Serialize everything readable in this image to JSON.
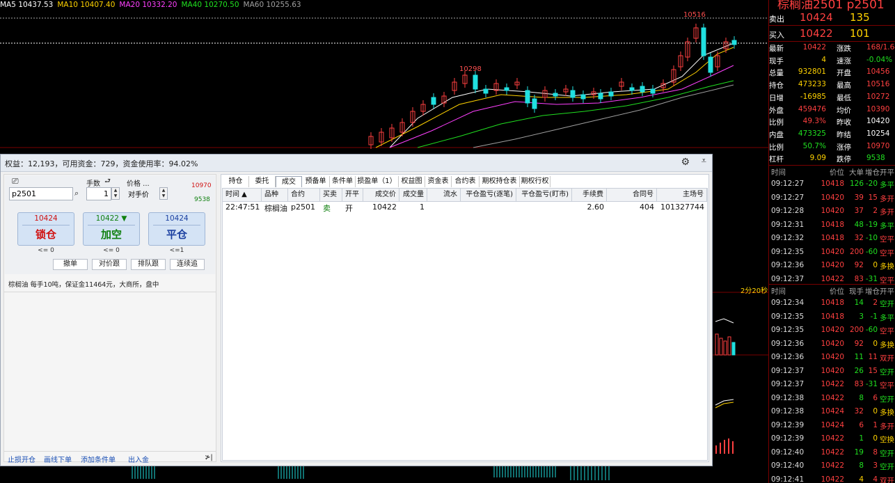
{
  "ma_legend": [
    {
      "label": "MA5 10437.53",
      "color": "#ffffff"
    },
    {
      "label": "MA10 10407.40",
      "color": "#ffd200"
    },
    {
      "label": "MA20 10332.20",
      "color": "#ff40ff"
    },
    {
      "label": "MA40 10270.50",
      "color": "#20e020"
    },
    {
      "label": "MA60 10255.63",
      "color": "#a0a0a0"
    }
  ],
  "chart_annotations": {
    "high_label": "10516",
    "mid_label": "10298",
    "time_label": "2分20秒"
  },
  "quote": {
    "title": "棕榈油2501 p2501",
    "ask": {
      "label": "卖出",
      "price": "10424",
      "volume": "135"
    },
    "bid": {
      "label": "买入",
      "price": "10422",
      "volume": "101"
    },
    "rows": [
      {
        "k1": "最新",
        "v1": "10422",
        "c1": "#ff4040",
        "k2": "涨跌",
        "v2": "168/1.64%",
        "c2": "#ff4040"
      },
      {
        "k1": "现手",
        "v1": "4",
        "c1": "#ffd200",
        "k2": "速涨",
        "v2": "-0.04%",
        "c2": "#20e020"
      },
      {
        "k1": "总量",
        "v1": "932801",
        "c1": "#ffd200",
        "k2": "开盘",
        "v2": "10456",
        "c2": "#ff4040"
      },
      {
        "k1": "持仓",
        "v1": "473233",
        "c1": "#ffd200",
        "k2": "最高",
        "v2": "10516",
        "c2": "#ff4040"
      },
      {
        "k1": "日增",
        "v1": "-16985",
        "c1": "#ffd200",
        "k2": "最低",
        "v2": "10272",
        "c2": "#ff4040"
      },
      {
        "k1": "外盘",
        "v1": "459476",
        "c1": "#ff4040",
        "k2": "均价",
        "v2": "10390",
        "c2": "#ff4040"
      },
      {
        "k1": "比例",
        "v1": "49.3%",
        "c1": "#ff4040",
        "k2": "昨收",
        "v2": "10420",
        "c2": "#ffffff"
      },
      {
        "k1": "内盘",
        "v1": "473325",
        "c1": "#20e020",
        "k2": "昨结",
        "v2": "10254",
        "c2": "#ffffff"
      },
      {
        "k1": "比例",
        "v1": "50.7%",
        "c1": "#20e020",
        "k2": "涨停",
        "v2": "10970",
        "c2": "#ff4040"
      },
      {
        "k1": "杠杆",
        "v1": "9.09",
        "c1": "#ffd200",
        "k2": "跌停",
        "v2": "9538",
        "c2": "#20e020"
      }
    ],
    "ticks1_header": {
      "time": "时间",
      "price": "价位",
      "vol": "大单",
      "chg": "增仓",
      "type": "开平"
    },
    "ticks1": [
      {
        "time": "09:12:27",
        "price": "10418",
        "vol": "126",
        "chg": "-20",
        "type": "多平",
        "vc": "#20e020",
        "tc": "#20e020"
      },
      {
        "time": "09:12:27",
        "price": "10420",
        "vol": "39",
        "chg": "15",
        "type": "多开",
        "vc": "#ff4040",
        "tc": "#ff4040"
      },
      {
        "time": "09:12:28",
        "price": "10420",
        "vol": "37",
        "chg": "2",
        "type": "多开",
        "vc": "#ff4040",
        "tc": "#ff4040"
      },
      {
        "time": "09:12:31",
        "price": "10418",
        "vol": "48",
        "chg": "-19",
        "type": "多平",
        "vc": "#20e020",
        "tc": "#20e020"
      },
      {
        "time": "09:12:32",
        "price": "10418",
        "vol": "32",
        "chg": "-10",
        "type": "空平",
        "vc": "#ff4040",
        "tc": "#ff4040"
      },
      {
        "time": "09:12:35",
        "price": "10420",
        "vol": "200",
        "chg": "-60",
        "type": "空平",
        "vc": "#ff4040",
        "tc": "#ff4040"
      },
      {
        "time": "09:12:36",
        "price": "10420",
        "vol": "92",
        "chg": "0",
        "type": "多换",
        "vc": "#ff4040",
        "tc": "#ffd200"
      },
      {
        "time": "09:12:37",
        "price": "10422",
        "vol": "83",
        "chg": "-31",
        "type": "空平",
        "vc": "#ff4040",
        "tc": "#ff4040"
      }
    ],
    "ticks2_header": {
      "time": "时间",
      "price": "价位",
      "vol": "现手",
      "chg": "增仓",
      "type": "开平"
    },
    "ticks2": [
      {
        "time": "09:12:34",
        "price": "10418",
        "vol": "14",
        "chg": "2",
        "type": "空开",
        "vc": "#20e020",
        "tc": "#20e020"
      },
      {
        "time": "09:12:35",
        "price": "10418",
        "vol": "3",
        "chg": "-1",
        "type": "多平",
        "vc": "#20e020",
        "tc": "#20e020"
      },
      {
        "time": "09:12:35",
        "price": "10420",
        "vol": "200",
        "chg": "-60",
        "type": "空平",
        "vc": "#ff4040",
        "tc": "#ff4040"
      },
      {
        "time": "09:12:36",
        "price": "10420",
        "vol": "92",
        "chg": "0",
        "type": "多换",
        "vc": "#ff4040",
        "tc": "#ffd200"
      },
      {
        "time": "09:12:36",
        "price": "10420",
        "vol": "11",
        "chg": "11",
        "type": "双开",
        "vc": "#20e020",
        "tc": "#ff4040"
      },
      {
        "time": "09:12:37",
        "price": "10420",
        "vol": "26",
        "chg": "15",
        "type": "空开",
        "vc": "#20e020",
        "tc": "#20e020"
      },
      {
        "time": "09:12:37",
        "price": "10422",
        "vol": "83",
        "chg": "-31",
        "type": "空平",
        "vc": "#ff4040",
        "tc": "#ff4040"
      },
      {
        "time": "09:12:38",
        "price": "10422",
        "vol": "8",
        "chg": "6",
        "type": "空开",
        "vc": "#20e020",
        "tc": "#20e020"
      },
      {
        "time": "09:12:38",
        "price": "10424",
        "vol": "32",
        "chg": "0",
        "type": "多换",
        "vc": "#ff4040",
        "tc": "#ffd200"
      },
      {
        "time": "09:12:39",
        "price": "10424",
        "vol": "6",
        "chg": "1",
        "type": "多开",
        "vc": "#ff4040",
        "tc": "#ff4040"
      },
      {
        "time": "09:12:39",
        "price": "10422",
        "vol": "1",
        "chg": "0",
        "type": "空换",
        "vc": "#20e020",
        "tc": "#ffd200"
      },
      {
        "time": "09:12:40",
        "price": "10422",
        "vol": "19",
        "chg": "8",
        "type": "空开",
        "vc": "#20e020",
        "tc": "#20e020"
      },
      {
        "time": "09:12:40",
        "price": "10422",
        "vol": "8",
        "chg": "3",
        "type": "空开",
        "vc": "#20e020",
        "tc": "#20e020"
      },
      {
        "time": "09:12:41",
        "price": "10422",
        "vol": "4",
        "chg": "4",
        "type": "双开",
        "vc": "#ffd200",
        "tc": "#ff4040"
      }
    ]
  },
  "trade": {
    "summary": "权益：12,193，可用资金：729，资金使用率：94.02%",
    "contract_value": "p2501",
    "qty_label": "手数",
    "qty_value": "1",
    "price_label": "价格 ...",
    "price_value": "对手价",
    "limit_up": "10970",
    "limit_down": "9538",
    "buttons": [
      {
        "price": "10424",
        "label": "锁仓",
        "limit": "<= 0",
        "price_color": "#d01010",
        "label_color": "#d01010"
      },
      {
        "price": "10422 ▼",
        "label": "加空",
        "limit": "<= 0",
        "price_color": "#108010",
        "label_color": "#108010"
      },
      {
        "price": "10424",
        "label": "平仓",
        "limit": "<=1",
        "price_color": "#1a3fa0",
        "label_color": "#1a3fa0"
      }
    ],
    "small_buttons": [
      "撤单",
      "对价跟",
      "排队跟",
      "连续追"
    ],
    "info": "棕榈油 每手10吨，保证金11464元，大商所，盘中",
    "links": [
      "止损开仓",
      "画线下单",
      "添加条件单",
      "出入金",
      "≯|"
    ],
    "tabs": [
      "持仓",
      "委托",
      "成交",
      "预备单",
      "条件单",
      "损盈单（1）",
      "权益图",
      "资金表",
      "合约表",
      "期权持仓表",
      "期权行权"
    ],
    "columns": [
      "时间 ▲",
      "品种",
      "合约",
      "买卖",
      "开平",
      "成交价",
      "成交量",
      "流水",
      "平仓盈亏(逐笔)",
      "平仓盈亏(盯市)",
      "手续费",
      "合同号",
      "主场号"
    ],
    "row": [
      "22:47:51",
      "棕榈油",
      "p2501",
      "卖",
      "开",
      "10422",
      "1",
      "",
      "",
      "",
      "2.60",
      "404",
      "101327744"
    ]
  }
}
